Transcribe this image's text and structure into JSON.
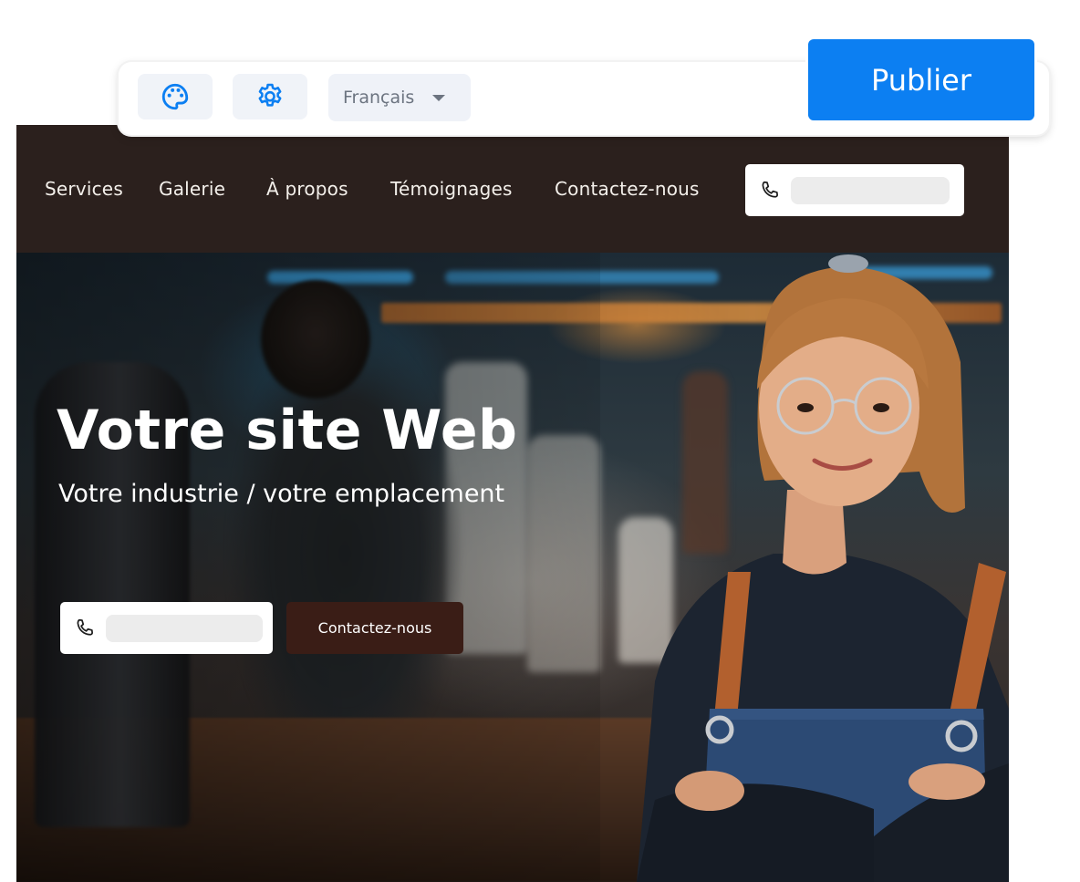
{
  "editor_toolbar": {
    "theme_button_icon": "palette-icon",
    "settings_button_icon": "gear-icon",
    "language_select": {
      "value": "Français",
      "icon": "caret-down-icon"
    },
    "publish_label": "Publier",
    "accent_color": "#0c7ff2"
  },
  "site": {
    "nav": {
      "items": [
        {
          "label": "Services"
        },
        {
          "label": "Galerie"
        },
        {
          "label": "À propos"
        },
        {
          "label": "Témoignages"
        },
        {
          "label": "Contactez-nous"
        }
      ],
      "phone_icon": "phone-icon",
      "background": "#2b201d"
    },
    "hero": {
      "title": "Votre site Web",
      "subtitle": "Votre industrie / votre emplacement",
      "cta_label": "Contactez-nous",
      "phone_icon": "phone-icon",
      "cta_color": "#3a1d16"
    }
  }
}
